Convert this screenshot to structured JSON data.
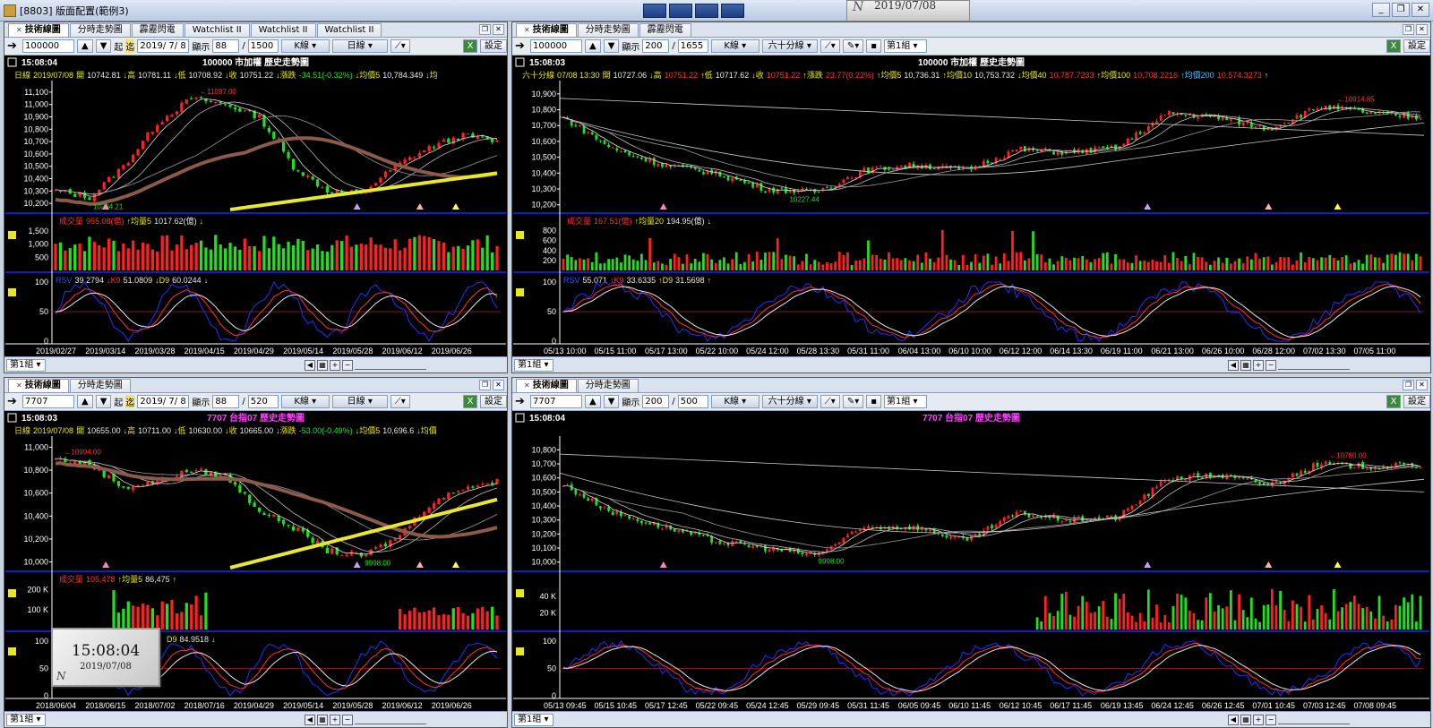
{
  "app": {
    "title": "[8803] 版面配置(範例3)"
  },
  "date_popup": {
    "text": "2019/07/08",
    "n": "N"
  },
  "clock": {
    "time": "15:08:04",
    "date": "2019/07/08",
    "n": "N"
  },
  "colors": {
    "up": "#ff2020",
    "down": "#20e020",
    "ma_brown": "#8b5a4a",
    "ma_yellow": "#e8e830",
    "bg": "#000000",
    "separator": "#1020c0",
    "kd_k": "#ff3030",
    "kd_d": "#e8e8e8",
    "rsv": "#2030ff"
  },
  "panels": [
    {
      "id": "tl",
      "tabs": [
        "技術線圖",
        "分時走勢圖",
        "霹靂閃電",
        "Watchlist II",
        "Watchlist II",
        "Watchlist II"
      ],
      "toolbar": {
        "code": "100000",
        "start_label": "起",
        "end_label": "迄",
        "date": "2019/ 7/ 8",
        "display_label": "顯示",
        "display_count": "88",
        "total": "1500",
        "chart_type": "K線",
        "period": "日線",
        "settings": "設定"
      },
      "header": {
        "time": "15:08:04",
        "title": "100000 市加權  歷史走勢圖"
      },
      "info": [
        {
          "t": "日線",
          "c": "#e8e820"
        },
        {
          "t": "2019/07/08",
          "c": "#e8e820"
        },
        {
          "t": "開",
          "c": "#e8e820"
        },
        {
          "t": "10742.81",
          "c": "#e8e8e8"
        },
        {
          "t": "↓高",
          "c": "#e8e820"
        },
        {
          "t": "10781.11",
          "c": "#e8e8e8"
        },
        {
          "t": "↓低",
          "c": "#e8e820"
        },
        {
          "t": "10708.92",
          "c": "#e8e8e8"
        },
        {
          "t": "↓收",
          "c": "#e8e820"
        },
        {
          "t": "10751.22",
          "c": "#e8e8e8"
        },
        {
          "t": "↓漲跌",
          "c": "#e8e820"
        },
        {
          "t": "-34.51(-0.32%)",
          "c": "#20e020"
        },
        {
          "t": "↓均價5",
          "c": "#e8e820"
        },
        {
          "t": "10,784.349",
          "c": "#e8e8e8"
        },
        {
          "t": "↓均",
          "c": "#e8e820"
        }
      ],
      "price_ticks": [
        "11,100",
        "11,000",
        "10,900",
        "10,800",
        "10,700",
        "10,600",
        "10,500",
        "10,400",
        "10,300",
        "10,200"
      ],
      "price_range": [
        10150,
        11150
      ],
      "high_label": "11097.00",
      "low_label": "10204.21",
      "volume_info": [
        {
          "t": "成交量",
          "c": "#ff3030"
        },
        {
          "t": "955.08(億)",
          "c": "#ff3030"
        },
        {
          "t": "↑均量5",
          "c": "#e8e820"
        },
        {
          "t": "1017.62(億)",
          "c": "#e8e8e8"
        },
        {
          "t": "↓",
          "c": "#e8e820"
        }
      ],
      "volume_ticks": [
        "1,500",
        "1,000",
        "500"
      ],
      "volume_max": 1700,
      "kd_info": [
        {
          "t": "RSV",
          "c": "#3050ff"
        },
        {
          "t": "39.2794",
          "c": "#e8e8e8"
        },
        {
          "t": "↓K9",
          "c": "#ff3030"
        },
        {
          "t": "51.0809",
          "c": "#e8e8e8"
        },
        {
          "t": "↓D9",
          "c": "#e8e820"
        },
        {
          "t": "60.0244",
          "c": "#e8e8e8"
        },
        {
          "t": "↓",
          "c": "#e8e820"
        }
      ],
      "kd_ticks": [
        "100",
        "50",
        "0"
      ],
      "x_labels": [
        "2019/02/27",
        "2019/03/14",
        "2019/03/28",
        "2019/04/15",
        "2019/04/29",
        "2019/05/14",
        "2019/05/28",
        "2019/06/12",
        "2019/06/26"
      ],
      "group": "第1組"
    },
    {
      "id": "tr",
      "tabs": [
        "技術線圖",
        "分時走勢圖",
        "霹靂閃電"
      ],
      "toolbar": {
        "code": "100000",
        "display_label": "顯示",
        "display_count": "200",
        "total": "1655",
        "chart_type": "K線",
        "period": "六十分線",
        "group": "第1組",
        "settings": "設定"
      },
      "header": {
        "time": "15:08:03",
        "title": "100000 市加權  歷史走勢圖"
      },
      "info": [
        {
          "t": "六十分線",
          "c": "#e8e820"
        },
        {
          "t": "07/08 13:30",
          "c": "#e8e820"
        },
        {
          "t": "開",
          "c": "#e8e820"
        },
        {
          "t": "10727.06",
          "c": "#e8e8e8"
        },
        {
          "t": "↓高",
          "c": "#e8e820"
        },
        {
          "t": "10751.22",
          "c": "#ff3030"
        },
        {
          "t": "↑低",
          "c": "#e8e820"
        },
        {
          "t": "10717.62",
          "c": "#e8e8e8"
        },
        {
          "t": "↓收",
          "c": "#e8e820"
        },
        {
          "t": "10751.22",
          "c": "#ff3030"
        },
        {
          "t": "↑漲跌",
          "c": "#e8e820"
        },
        {
          "t": "23.77(0.22%)",
          "c": "#ff3030"
        },
        {
          "t": "↑均價5",
          "c": "#e8e820"
        },
        {
          "t": "10,736.31",
          "c": "#e8e8e8"
        },
        {
          "t": "↑均價10",
          "c": "#e8e820"
        },
        {
          "t": "10,753.732",
          "c": "#e8e8e8"
        },
        {
          "t": "↓均價40",
          "c": "#e8e820"
        },
        {
          "t": "10,787.7233",
          "c": "#ff3030"
        },
        {
          "t": "↑均價100",
          "c": "#e8e820"
        },
        {
          "t": "10,708.2216",
          "c": "#ff3030"
        },
        {
          "t": "↑均價200",
          "c": "#40c0ff"
        },
        {
          "t": "10,574.3273",
          "c": "#ff3030"
        },
        {
          "t": "↑",
          "c": "#e8e820"
        }
      ],
      "price_ticks": [
        "10,900",
        "10,800",
        "10,700",
        "10,600",
        "10,500",
        "10,400",
        "10,300",
        "10,200"
      ],
      "price_range": [
        10170,
        10950
      ],
      "high_label": "10914.85",
      "low_label": "10227.44",
      "volume_info": [
        {
          "t": "成交量",
          "c": "#ff3030"
        },
        {
          "t": "167.51(億)",
          "c": "#ff3030"
        },
        {
          "t": "↑均量20",
          "c": "#e8e820"
        },
        {
          "t": "194.95(億)",
          "c": "#e8e8e8"
        },
        {
          "t": "↓",
          "c": "#e8e820"
        }
      ],
      "volume_ticks": [
        "800",
        "600",
        "400",
        "200"
      ],
      "volume_max": 900,
      "kd_info": [
        {
          "t": "RSV",
          "c": "#3050ff"
        },
        {
          "t": "55.071",
          "c": "#e8e8e8"
        },
        {
          "t": "↑K9",
          "c": "#ff3030"
        },
        {
          "t": "33.6335",
          "c": "#e8e8e8"
        },
        {
          "t": "↑D9",
          "c": "#e8e820"
        },
        {
          "t": "31.5698",
          "c": "#e8e8e8"
        },
        {
          "t": "↑",
          "c": "#e8e820"
        }
      ],
      "kd_ticks": [
        "100",
        "50",
        "0"
      ],
      "x_labels": [
        "05/13 10:00",
        "05/15 11:00",
        "05/17 13:00",
        "05/22 10:00",
        "05/24 12:00",
        "05/28 13:30",
        "05/31 11:00",
        "06/04 13:00",
        "06/10 10:00",
        "06/12 12:00",
        "06/14 13:30",
        "06/19 11:00",
        "06/21 13:00",
        "06/26 10:00",
        "06/28 12:00",
        "07/02 13:30",
        "07/05 11:00"
      ],
      "group": "第1組"
    },
    {
      "id": "bl",
      "tabs": [
        "技術線圖",
        "分時走勢圖"
      ],
      "toolbar": {
        "code": "7707",
        "start_label": "起",
        "end_label": "迄",
        "date": "2019/ 7/ 8",
        "display_label": "顯示",
        "display_count": "88",
        "total": "520",
        "chart_type": "K線",
        "period": "日線",
        "settings": "設定"
      },
      "header": {
        "time": "15:08:03",
        "title": "7707 台指07  歷史走勢圖"
      },
      "info": [
        {
          "t": "日線",
          "c": "#e8e820"
        },
        {
          "t": "2019/07/08",
          "c": "#e8e820"
        },
        {
          "t": "開",
          "c": "#e8e820"
        },
        {
          "t": "10655.00",
          "c": "#e8e8e8"
        },
        {
          "t": "↓高",
          "c": "#e8e820"
        },
        {
          "t": "10711.00",
          "c": "#e8e8e8"
        },
        {
          "t": "↓低",
          "c": "#e8e820"
        },
        {
          "t": "10630.00",
          "c": "#e8e8e8"
        },
        {
          "t": "↓收",
          "c": "#e8e820"
        },
        {
          "t": "10665.00",
          "c": "#e8e8e8"
        },
        {
          "t": "↓漲跌",
          "c": "#e8e820"
        },
        {
          "t": "-53.00(-0.49%)",
          "c": "#20e020"
        },
        {
          "t": "↓均價5",
          "c": "#e8e820"
        },
        {
          "t": "10,696.6",
          "c": "#e8e8e8"
        },
        {
          "t": "↓均價",
          "c": "#e8e820"
        }
      ],
      "price_ticks": [
        "11,000",
        "10,800",
        "10,600",
        "10,400",
        "10,200",
        "10,000"
      ],
      "price_range": [
        9950,
        11050
      ],
      "high_label": "10994.00",
      "low_label": "9998.00",
      "volume_info": [
        {
          "t": "成交量",
          "c": "#ff3030"
        },
        {
          "t": "105,478",
          "c": "#ff3030"
        },
        {
          "t": "↑均量5",
          "c": "#e8e820"
        },
        {
          "t": "86,475",
          "c": "#e8e8e8"
        },
        {
          "t": "↑",
          "c": "#e8e820"
        }
      ],
      "volume_ticks": [
        "200 K",
        "100 K"
      ],
      "volume_max": 230000,
      "kd_info": [
        {
          "t": "D9",
          "c": "#e8e820"
        },
        {
          "t": "84.9518",
          "c": "#e8e8e8"
        },
        {
          "t": "↓",
          "c": "#e8e820"
        }
      ],
      "kd_ticks": [
        "100",
        "50",
        "0"
      ],
      "x_labels": [
        "2018/06/04",
        "2018/06/15",
        "2018/07/02",
        "2018/07/16",
        "2019/04/29",
        "2019/05/14",
        "2019/05/28",
        "2019/06/12",
        "2019/06/26"
      ],
      "group": "第1組"
    },
    {
      "id": "br",
      "tabs": [
        "技術線圖",
        "分時走勢圖"
      ],
      "toolbar": {
        "code": "7707",
        "display_label": "顯示",
        "display_count": "200",
        "total": "500",
        "chart_type": "K線",
        "period": "六十分線",
        "group": "第1組",
        "settings": "設定"
      },
      "header": {
        "time": "15:08:04",
        "title": "7707 台指07  歷史走勢圖"
      },
      "info": [],
      "price_ticks": [
        "10,800",
        "10,700",
        "10,600",
        "10,500",
        "10,400",
        "10,300",
        "10,200",
        "10,100",
        "10,000"
      ],
      "price_range": [
        9960,
        10860
      ],
      "high_label": "10780.00",
      "low_label": "9998.00",
      "volume_info": [],
      "volume_ticks": [
        "40 K",
        "20 K"
      ],
      "volume_max": 55000,
      "kd_info": [],
      "kd_ticks": [
        "100",
        "50",
        "0"
      ],
      "x_labels": [
        "05/13 09:45",
        "05/15 10:45",
        "05/17 12:45",
        "05/22 09:45",
        "05/24 12:45",
        "05/29 09:45",
        "05/31 11:45",
        "06/05 09:45",
        "06/10 11:45",
        "06/12 10:45",
        "06/17 11:45",
        "06/19 13:45",
        "06/24 12:45",
        "06/26 12:45",
        "07/01 10:45",
        "07/03 12:45",
        "07/08 09:45"
      ],
      "group": "第1組"
    }
  ]
}
